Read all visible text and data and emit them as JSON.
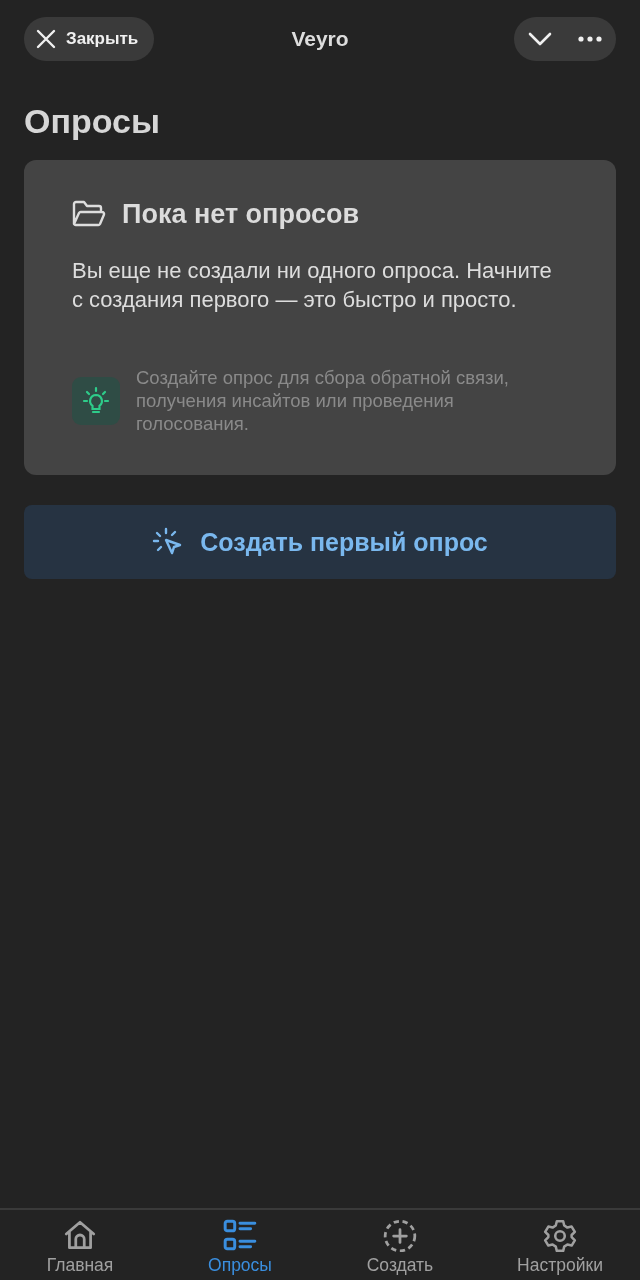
{
  "header": {
    "close_label": "Закрыть",
    "title": "Veyro"
  },
  "page_title": "Опросы",
  "empty_state": {
    "title": "Пока нет опросов",
    "text": "Вы еще не создали ни одного опроса. Начните с создания первого — это быстро и просто.",
    "tip": "Создайте опрос для сбора обратной связи, получения инсайтов или проведения голосования."
  },
  "create_button": {
    "label": "Создать первый опрос"
  },
  "tabs": [
    {
      "kind": "home",
      "label": "Главная",
      "selected": false
    },
    {
      "kind": "list",
      "label": "Опросы",
      "selected": true
    },
    {
      "kind": "create",
      "label": "Создать",
      "selected": false
    },
    {
      "kind": "settings",
      "label": "Настройки",
      "selected": false
    }
  ]
}
